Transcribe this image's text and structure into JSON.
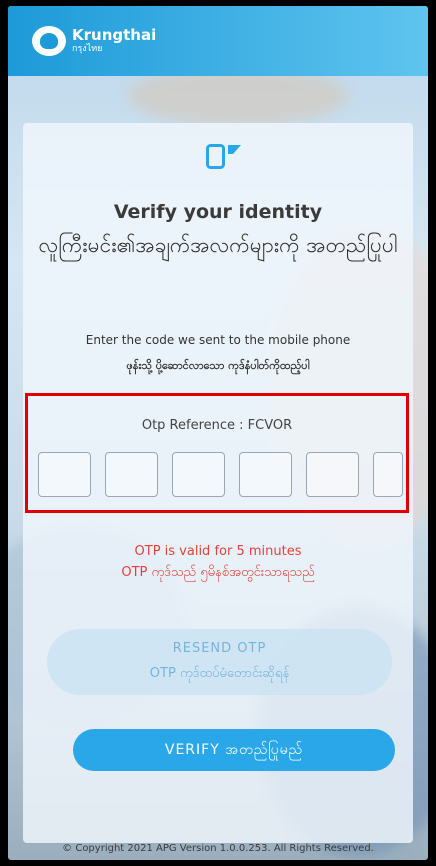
{
  "header": {
    "brand_name": "Krungthai",
    "brand_sub": "กรุงไทย"
  },
  "card": {
    "title_en": "Verify your identity",
    "title_my": "လူကြီးမင်း၏အချက်အလက်များကို အတည်ပြုပါ",
    "instruction_en": "Enter the code we sent to the mobile phone",
    "instruction_my": "ဖုန်းသို့ ပို့ဆောင်လာသော ကုဒ်နံပါတ်ကိုထည့်ပါ",
    "otp_reference": "Otp Reference : FCVOR",
    "otp_digits": [
      "",
      "",
      "",
      "",
      "",
      ""
    ],
    "valid_en": "OTP is valid for 5 minutes",
    "valid_my": "OTP ကုဒ်သည် ၅မိနစ်အတွင်းသာရသည်",
    "resend_en": "RESEND OTP",
    "resend_my": "OTP ကုဒ်ထပ်မံတောင်းဆိုရန်",
    "verify_label": "VERIFY အတည်ပြုမည်"
  },
  "footer": {
    "copyright": "© Copyright 2021 APG Version 1.0.0.253. All Rights Reserved."
  },
  "colors": {
    "header_start": "#1d9ad8",
    "header_end": "#5fc4ef",
    "verify_button": "#2aa7e8",
    "error_text": "#e0433a",
    "highlight_box": "#e00000"
  },
  "icons": [
    "logo-icon",
    "mobile-phone-icon"
  ]
}
